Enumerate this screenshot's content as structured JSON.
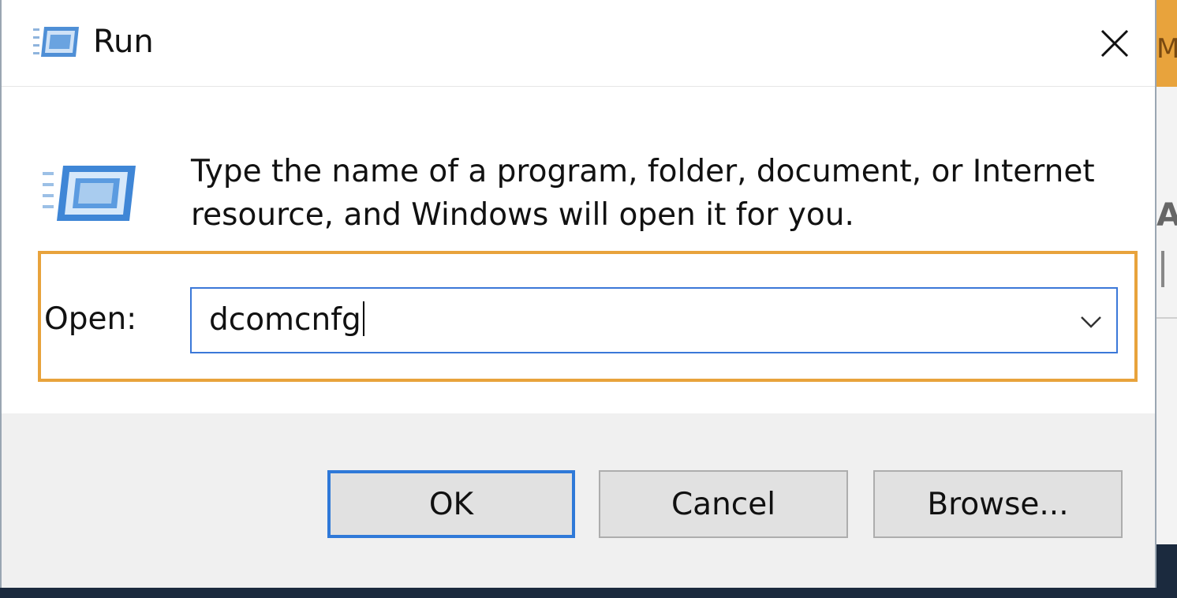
{
  "window": {
    "title": "Run",
    "icon": "run-icon",
    "close_icon": "close-icon"
  },
  "prompt": {
    "description": "Type the name of a program, folder, document, or Internet resource, and Windows will open it for you."
  },
  "open_field": {
    "label": "Open:",
    "value": "dcomcnfg",
    "dropdown_icon": "chevron-down-icon"
  },
  "buttons": {
    "ok": "OK",
    "cancel": "Cancel",
    "browse": "Browse..."
  },
  "colors": {
    "highlight": "#e8a33c",
    "focus": "#2f79d8"
  }
}
